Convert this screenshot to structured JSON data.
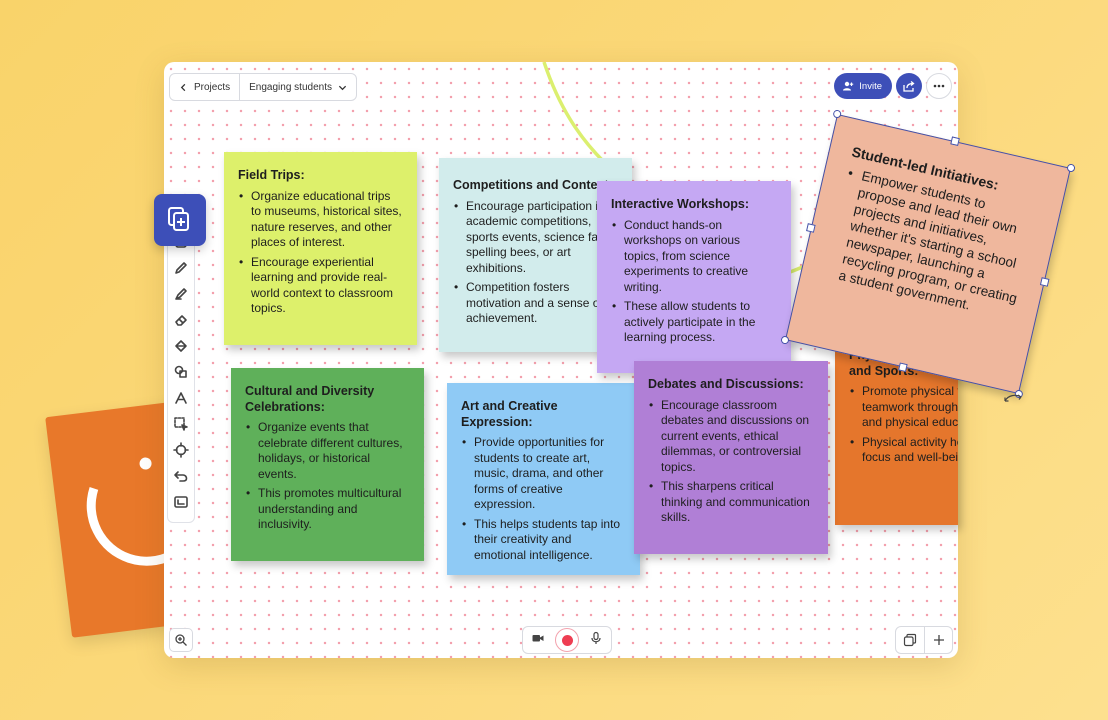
{
  "colors": {
    "accent": "#3d4fb8",
    "record": "#ee3d52",
    "background": "#fbd879"
  },
  "topbar": {
    "back_icon": "chevron-left-icon",
    "breadcrumb_root": "Projects",
    "board_name": "Engaging students",
    "dropdown_icon": "chevron-down-icon"
  },
  "top_right": {
    "invite_label": "Invite",
    "invite_icon": "add-user-icon",
    "share_icon": "share-icon",
    "more_icon": "more-horizontal-icon"
  },
  "add_board_icon": "copy-plus-icon",
  "toolbar": {
    "tools": [
      {
        "name": "sticky-note-icon"
      },
      {
        "name": "pencil-icon"
      },
      {
        "name": "marker-icon"
      },
      {
        "name": "eraser-icon"
      },
      {
        "name": "fill-bucket-icon"
      },
      {
        "name": "shapes-icon"
      },
      {
        "name": "text-icon"
      },
      {
        "name": "select-area-icon"
      },
      {
        "name": "laser-pointer-icon"
      },
      {
        "name": "undo-icon"
      },
      {
        "name": "frame-icon"
      }
    ]
  },
  "notes": [
    {
      "title": "Field Trips:",
      "color": "#ddf06b",
      "bullets": [
        "Organize educational trips to museums, historical sites, nature reserves, and other places of interest.",
        "Encourage experiential learning and provide real-world context to classroom topics."
      ]
    },
    {
      "title": "Competitions and Contests:",
      "color": "#d2ecec",
      "bullets": [
        "Encourage participation in academic competitions, sports events, science fairs, spelling bees, or art exhibitions.",
        "Competition fosters motivation and a sense of achievement."
      ]
    },
    {
      "title": "Interactive Workshops:",
      "color": "#c5a8f3",
      "bullets": [
        "Conduct hands-on workshops on various topics, from science experiments to creative writing.",
        "These allow students to actively participate in the learning process."
      ]
    },
    {
      "title": "Cultural and Diversity Celebrations:",
      "color": "#5fb05a",
      "bullets": [
        "Organize events that celebrate different cultures, holidays, or historical events.",
        "This promotes multicultural understanding and inclusivity."
      ]
    },
    {
      "title": "Art and Creative Expression:",
      "color": "#8fcaf5",
      "bullets": [
        "Provide opportunities for students to create art, music, drama, and other forms of creative expression.",
        "This helps students tap into their creativity and emotional intelligence."
      ]
    },
    {
      "title": "Debates and Discussions:",
      "color": "#b07fd6",
      "bullets": [
        "Encourage classroom debates and discussions on current events, ethical dilemmas, or controversial topics.",
        "This sharpens critical thinking and communication skills."
      ]
    },
    {
      "title": "Physical Education and Sports:",
      "color": "#e5762c",
      "bullets": [
        "Promote physical fitness and teamwork through sports, games, and physical education classes.",
        "Physical activity helps improve focus and well-being."
      ]
    }
  ],
  "selected_note": {
    "title": "Student-led Initiatives:",
    "color": "#efb79d",
    "bullets": [
      "Empower students to propose and lead their own projects and initiatives, whether it's starting a school newspaper, launching a recycling program, or creating a student government."
    ],
    "rotate_icon": "rotate-icon"
  },
  "bottom_bar": {
    "zoom_icon": "zoom-in-icon",
    "camera_icon": "video-camera-icon",
    "record_icon": "record-icon",
    "mic_icon": "microphone-icon",
    "pages_icon": "pages-icon",
    "add_icon": "plus-icon"
  }
}
